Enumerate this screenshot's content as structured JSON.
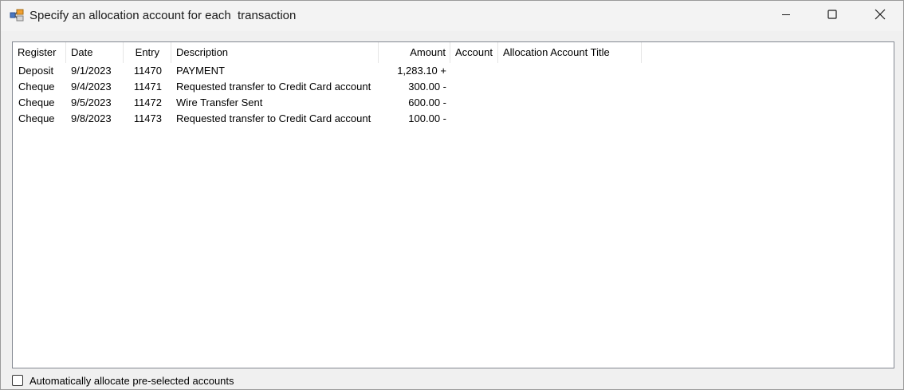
{
  "window": {
    "title": "Specify an allocation account for each  transaction",
    "icon": "app-icon",
    "controls": {
      "minimize": "minimize-icon",
      "maximize": "maximize-icon",
      "close": "close-icon"
    }
  },
  "table": {
    "columns": [
      "Register",
      "Date",
      "Entry",
      "Description",
      "Amount",
      "Account",
      "Allocation Account Title"
    ],
    "rows": [
      {
        "register": "Deposit",
        "date": "9/1/2023",
        "entry": "11470",
        "description": "PAYMENT",
        "amount": "1,283.10 +",
        "account": "",
        "title": ""
      },
      {
        "register": "Cheque",
        "date": "9/4/2023",
        "entry": "11471",
        "description": "Requested transfer to Credit Card account",
        "amount": "300.00 -",
        "account": "",
        "title": ""
      },
      {
        "register": "Cheque",
        "date": "9/5/2023",
        "entry": "11472",
        "description": "Wire Transfer Sent",
        "amount": "600.00 -",
        "account": "",
        "title": ""
      },
      {
        "register": "Cheque",
        "date": "9/8/2023",
        "entry": "11473",
        "description": "Requested transfer to Credit Card account",
        "amount": "100.00 -",
        "account": "",
        "title": ""
      }
    ]
  },
  "footer": {
    "auto_allocate_label": "Automatically allocate pre-selected accounts",
    "auto_allocate_checked": false
  }
}
